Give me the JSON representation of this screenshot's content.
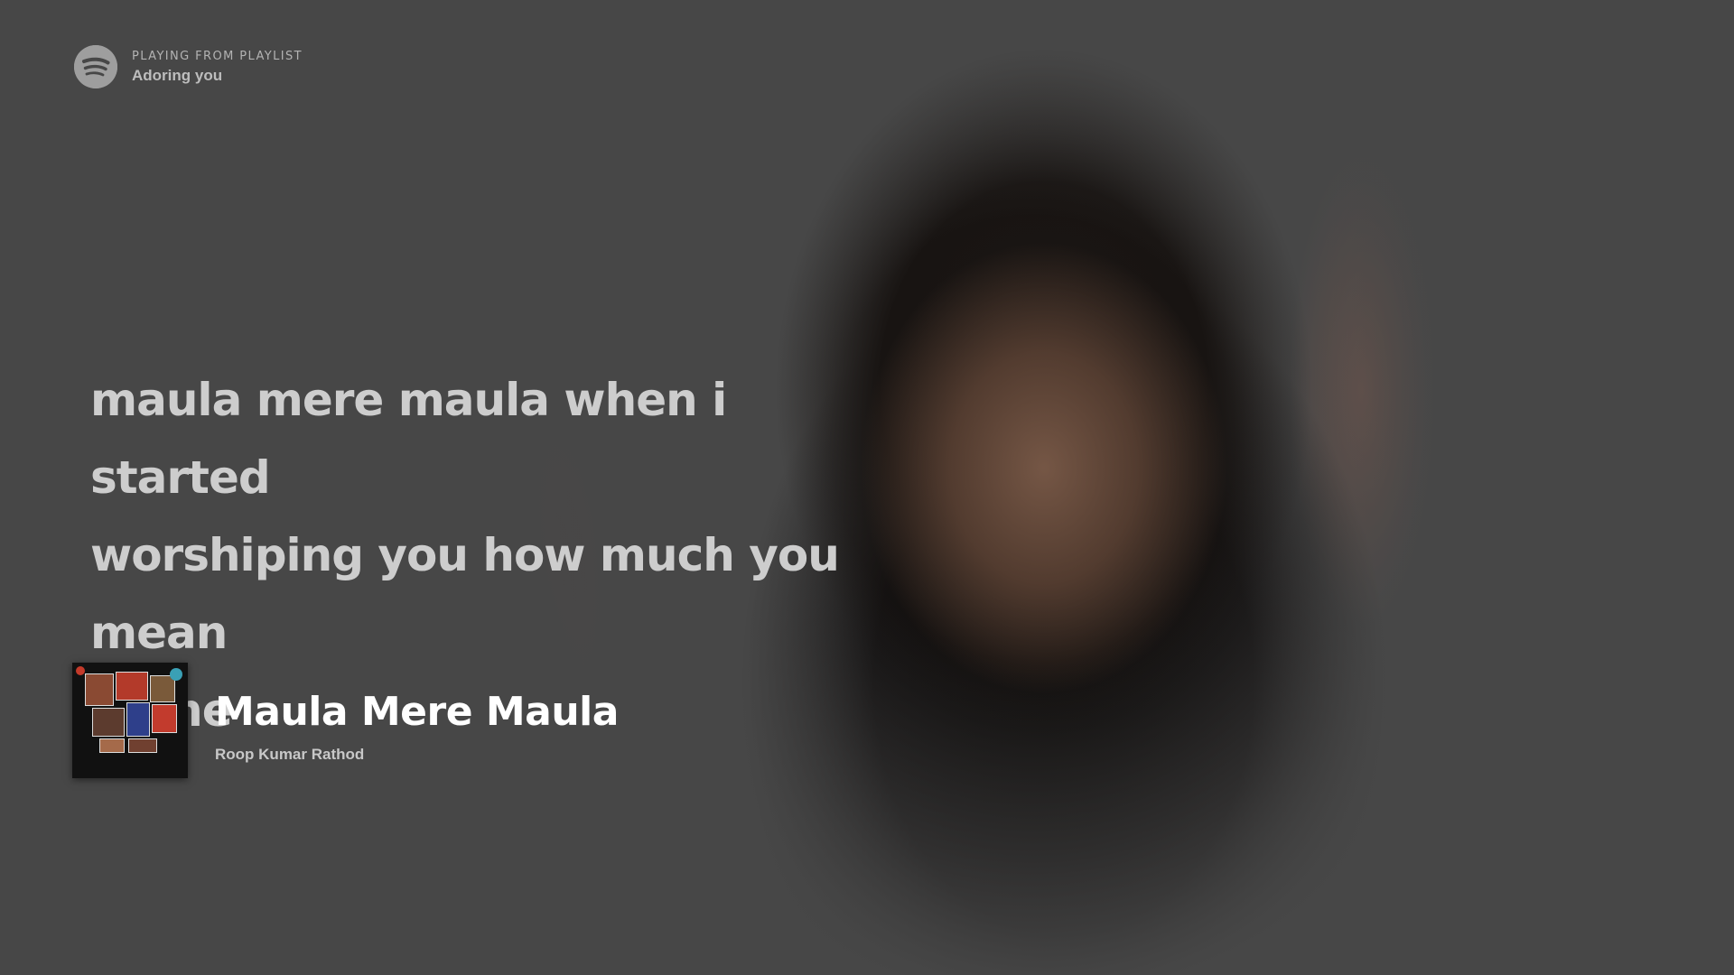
{
  "context": {
    "logo_icon": "spotify-icon",
    "label": "PLAYING FROM PLAYLIST",
    "name": "Adoring you"
  },
  "lyrics": {
    "lines": [
      "maula mere maula when i started",
      "worshiping you how much you mean",
      "to me"
    ]
  },
  "track": {
    "title": "Maula Mere Maula",
    "artist": "Roop Kumar Rathod"
  },
  "colors": {
    "background": "#474747",
    "lyrics_text": "#cdcdcd",
    "title_text": "#ffffff",
    "secondary_text": "#b3b3b3"
  }
}
